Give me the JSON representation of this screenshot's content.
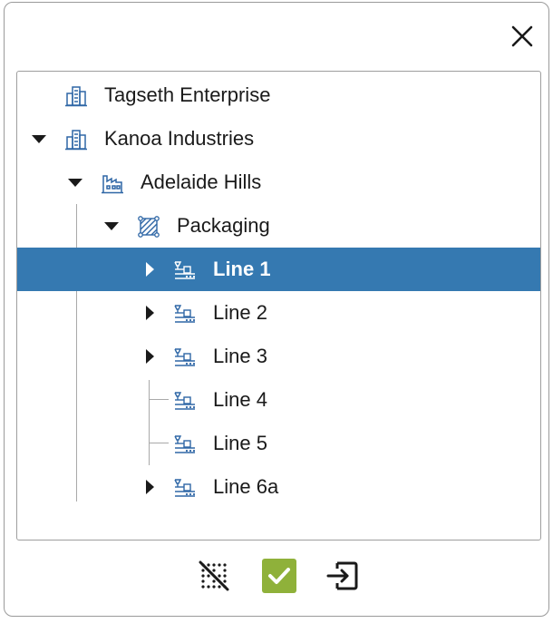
{
  "colors": {
    "selection": "#3579b1",
    "icon_blue": "#2f67a6",
    "confirm_green": "#8fb13a"
  },
  "dialog": {
    "close_icon": "close-icon"
  },
  "tree": {
    "items": [
      {
        "label": "Tagseth Enterprise",
        "icon": "enterprise-building-icon",
        "expanded": null
      },
      {
        "label": "Kanoa Industries",
        "icon": "enterprise-building-icon",
        "expanded": true
      },
      {
        "label": "Adelaide Hills",
        "icon": "site-factory-icon",
        "expanded": true
      },
      {
        "label": "Packaging",
        "icon": "area-hatched-icon",
        "expanded": true
      },
      {
        "label": "Line 1",
        "icon": "production-line-icon",
        "expanded": false,
        "selected": true
      },
      {
        "label": "Line 2",
        "icon": "production-line-icon",
        "expanded": false
      },
      {
        "label": "Line 3",
        "icon": "production-line-icon",
        "expanded": false
      },
      {
        "label": "Line 4",
        "icon": "production-line-icon",
        "expanded": null
      },
      {
        "label": "Line 5",
        "icon": "production-line-icon",
        "expanded": null
      },
      {
        "label": "Line 6a",
        "icon": "production-line-icon",
        "expanded": false
      }
    ]
  },
  "actions": {
    "clear_icon": "clear-selection-icon",
    "confirm_icon": "confirm-check-icon",
    "exit_icon": "exit-icon"
  }
}
